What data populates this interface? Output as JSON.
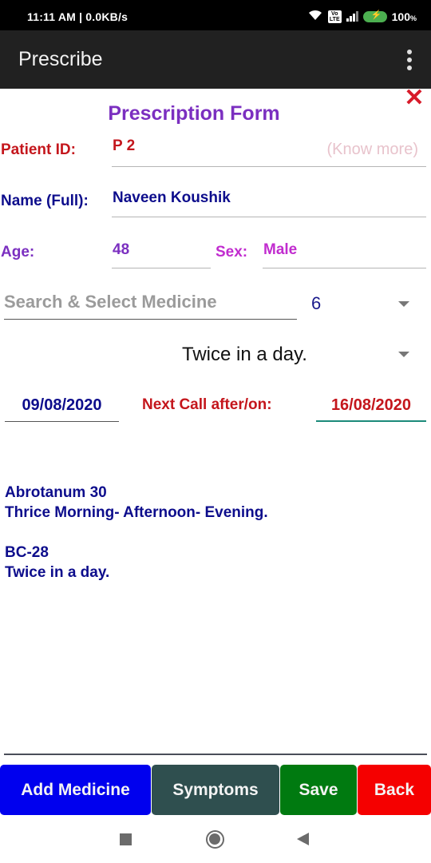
{
  "status_bar": {
    "time_speed": "11:11 AM | 0.0KB/s",
    "network": "4G",
    "volte": "Vo LTE",
    "battery": "100",
    "battery_unit": "%"
  },
  "app_bar": {
    "title": "Prescribe",
    "menu_icon": "more-vert-icon"
  },
  "form": {
    "close_icon": "close-x-icon",
    "title": "Prescription Form",
    "patient_id_label": "Patient ID:",
    "patient_id_value": "P 2",
    "know_more_link": "(Know more)",
    "name_label": "Name (Full):",
    "name_value": "Naveen Koushik",
    "age_label": "Age:",
    "age_value": "48",
    "sex_label": "Sex:",
    "sex_value": "Male",
    "medicine_search_placeholder": "Search & Select Medicine",
    "quantity_selected": "6",
    "dosage_selected": "Twice in a day.",
    "date_value": "09/08/2020",
    "next_call_label": "Next Call after/on:",
    "next_call_value": "16/08/2020"
  },
  "prescribed_medicines": [
    {
      "name": "Abrotanum 30",
      "dosage": "Thrice Morning- Afternoon- Evening."
    },
    {
      "name": "BC-28",
      "dosage": "Twice in a day."
    }
  ],
  "buttons": {
    "add_medicine": "Add Medicine",
    "symptoms": "Symptoms",
    "save": "Save",
    "back": "Back"
  },
  "colors": {
    "title_purple": "#7b2fc0",
    "label_red": "#c4161c",
    "label_blue": "#0d0d8c",
    "age_purple": "#7b2fc0",
    "sex_magenta": "#c12ccf",
    "btn_add": "#0000ee",
    "btn_symptoms": "#2f4f4f",
    "btn_save": "#007a10",
    "btn_back": "#f50000"
  }
}
